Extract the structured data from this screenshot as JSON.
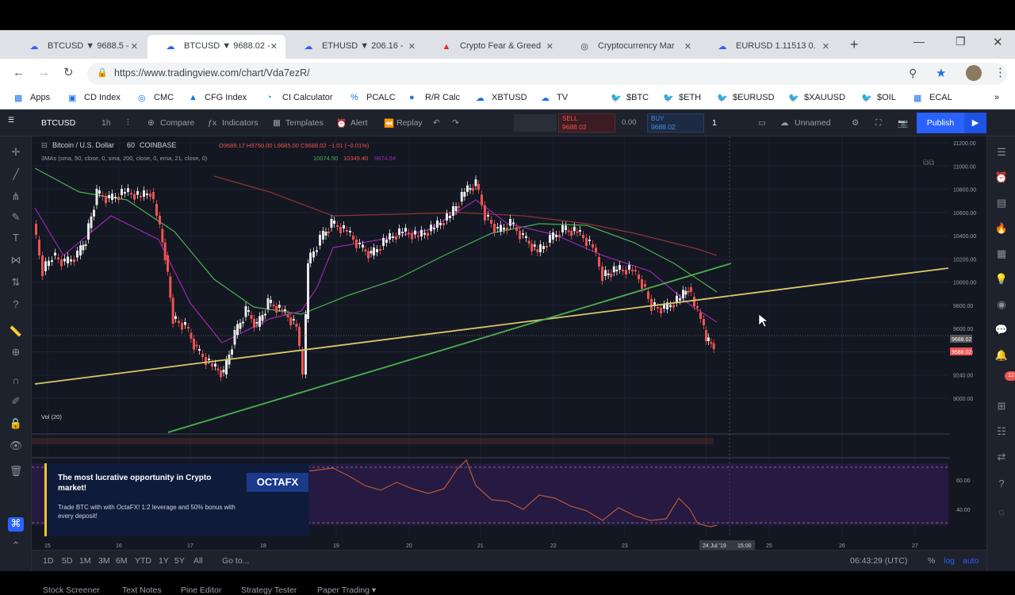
{
  "tabs": [
    {
      "label": "BTCUSD ▼ 9688.5 -",
      "active": false
    },
    {
      "label": "BTCUSD ▼ 9688.02 -",
      "active": true
    },
    {
      "label": "ETHUSD ▼ 206.16 -",
      "active": false
    },
    {
      "label": "Crypto Fear & Greed",
      "active": false
    },
    {
      "label": "Cryptocurrency Mar",
      "active": false
    },
    {
      "label": "EURUSD 1.11513 0.",
      "active": false
    }
  ],
  "address": {
    "url": "https://www.tradingview.com/chart/Vda7ezR/"
  },
  "bookmarks": [
    "Apps",
    "CD Index",
    "CMC",
    "CFG Index",
    "CI Calculator",
    "PCALC",
    "R/R Calc",
    "XBTUSD",
    "TV",
    "$BTC",
    "$ETH",
    "$EURUSD",
    "$XAUUSD",
    "$OIL",
    "ECAL"
  ],
  "toolbar": {
    "symbol": "BTCUSD",
    "interval": "1h",
    "compare": "Compare",
    "indicators": "Indicators",
    "templates": "Templates",
    "alert": "Alert",
    "replay": "Replay",
    "sell_label": "SELL",
    "sell_price": "9688.02",
    "spread": "0.00",
    "buy_label": "BUY",
    "buy_price": "9688.02",
    "qty": "1",
    "layout": "Unnamed",
    "publish": "Publish"
  },
  "legend": {
    "title": "Bitcoin / U.S. Dollar",
    "interval": "60",
    "exchange": "COINBASE",
    "ohlc": "O9689.17 H9750.00 L9685.00 C9688.02 −1.01 (−0.01%)",
    "ma_label": "3MAs (sma, 50, close, 0, sma, 200, close, 0, ema, 21, close, 0)",
    "ma1": "10074.50",
    "ma2": "10349.40",
    "ma3": "9874.94",
    "volume": "Vol (20)"
  },
  "price_axis": [
    "11200.00",
    "11000.00",
    "10800.00",
    "10600.00",
    "10400.00",
    "10200.00",
    "10000.00",
    "9800.00",
    "9600.00",
    "9440.00",
    "9240.00",
    "9000.00"
  ],
  "price_tags": {
    "current": "9688.02",
    "red": "9688.02"
  },
  "rsi_axis": [
    "60.00",
    "40.00"
  ],
  "time_axis": [
    "15",
    "16",
    "17",
    "18",
    "19",
    "20",
    "21",
    "22",
    "23",
    "24 Jul '19",
    "25",
    "26",
    "27"
  ],
  "cursor_time": "15:00",
  "bottom": {
    "ranges": [
      "1D",
      "5D",
      "1M",
      "3M",
      "6M",
      "YTD",
      "1Y",
      "5Y",
      "All"
    ],
    "goto": "Go to...",
    "clock": "06:43:29 (UTC)",
    "pct": "%",
    "log": "log",
    "auto": "auto",
    "panels": [
      "Stock Screener",
      "Text Notes",
      "Pine Editor",
      "Strategy Tester",
      "Paper Trading ▾"
    ]
  },
  "ad": {
    "title": "The most lucrative opportunity in Crypto market!",
    "body": "Trade BTC with with OctaFX! 1:2 leverage and 50% bonus with every deposit!",
    "brand": "OCTAFX"
  },
  "notification_badge": "12",
  "colors": {
    "up": "#26a69a",
    "down": "#ef5350",
    "bg": "#131722",
    "publish": "#2962ff",
    "trend_green": "#4caf50",
    "trend_yellow": "#d8c96a",
    "rsi": "#a0522d"
  }
}
